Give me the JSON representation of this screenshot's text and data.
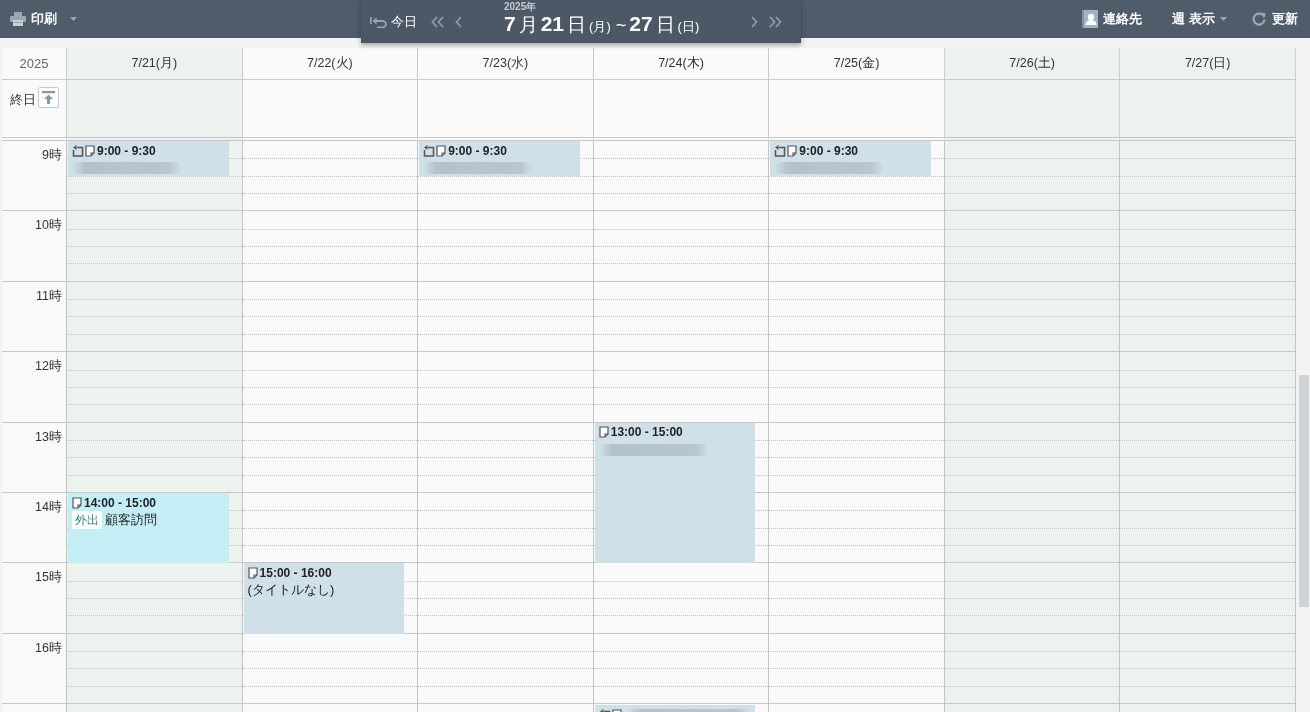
{
  "toolbar": {
    "print": {
      "label": "印刷"
    },
    "contacts": {
      "label": "連絡先"
    },
    "view_menu": {
      "label": "週 表示"
    },
    "refresh": {
      "label": "更新"
    }
  },
  "navigator": {
    "today": "今日",
    "year": "2025年",
    "range": [
      {
        "kind": "number",
        "text": "7"
      },
      {
        "kind": "unit",
        "text": "月"
      },
      {
        "kind": "number",
        "text": "21"
      },
      {
        "kind": "unit",
        "text": "日"
      },
      {
        "kind": "weekday",
        "text": "(月)"
      },
      {
        "kind": "separator",
        "text": "~"
      },
      {
        "kind": "number",
        "text": "27"
      },
      {
        "kind": "unit",
        "text": "日"
      },
      {
        "kind": "weekday",
        "text": "(日)"
      }
    ]
  },
  "calendar": {
    "corner": "2025",
    "all_day_label": "終日",
    "hours": [
      "9時",
      "10時",
      "11時",
      "12時",
      "13時",
      "14時",
      "15時",
      "16時"
    ],
    "days": [
      {
        "label": "7/21(月)",
        "off_day": true,
        "events": [
          {
            "time": "9:00 - 9:30",
            "recurring": true,
            "redacted": true,
            "color": "#cfe0e8"
          },
          {
            "time": "14:00 - 15:00",
            "recurring": false,
            "redacted": false,
            "tag": "外出",
            "title": "顧客訪問",
            "color": "#c4eef5"
          }
        ]
      },
      {
        "label": "7/22(火)",
        "off_day": false,
        "events": [
          {
            "time": "15:00 - 16:00",
            "recurring": false,
            "redacted": false,
            "title": "(タイトルなし)",
            "color": "#cfe0e8"
          }
        ]
      },
      {
        "label": "7/23(水)",
        "off_day": false,
        "events": [
          {
            "time": "9:00 - 9:30",
            "recurring": true,
            "redacted": true,
            "color": "#cfe0e8"
          }
        ]
      },
      {
        "label": "7/24(木)",
        "off_day": false,
        "events": [
          {
            "time": "13:00 - 15:00",
            "recurring": false,
            "redacted": true,
            "color": "#cfe0e8"
          },
          {
            "recurring": true,
            "redacted": true,
            "color": "#cfe0e8"
          }
        ]
      },
      {
        "label": "7/25(金)",
        "off_day": false,
        "events": [
          {
            "time": "9:00 - 9:30",
            "recurring": true,
            "redacted": true,
            "color": "#cfe0e8"
          }
        ]
      },
      {
        "label": "7/26(土)",
        "off_day": true
      },
      {
        "label": "7/27(日)",
        "off_day": true
      }
    ]
  }
}
